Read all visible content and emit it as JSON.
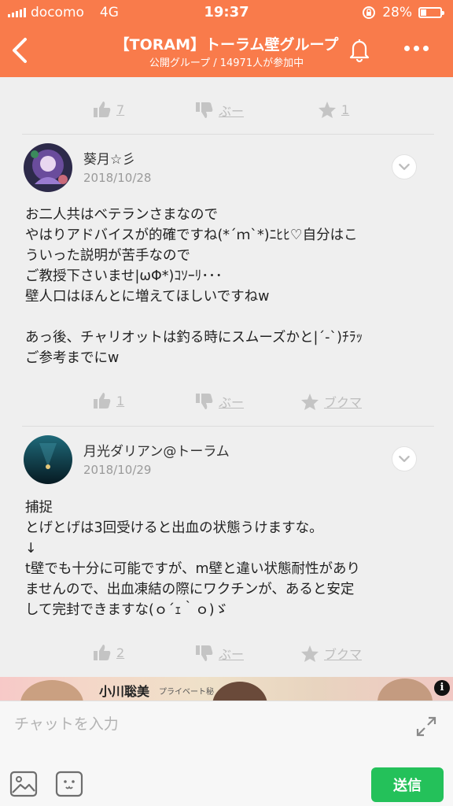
{
  "status_bar": {
    "carrier": "docomo",
    "network": "4G",
    "time": "19:37",
    "battery": "28%",
    "battery_level": 0.28
  },
  "header": {
    "title": "【TORAM】トーラム壁グループ",
    "subtitle": "公開グループ / 14971人が参加中"
  },
  "top_reactions": {
    "like": "7",
    "boo": "ぶー",
    "star": "1"
  },
  "posts": [
    {
      "author": "葵月☆彡",
      "date": "2018/10/28",
      "body": "お二人共はベテランさまなので\nやはりアドバイスが的確ですね(*´ｍ`*)ﾆﾋﾋ♡自分はこ\nういった説明が苦手なので\nご教授下さいませ|ωΦ*)ｺｿｰﾘ･･･\n壁人口はほんとに増えてほしいですねw\n\nあっ後、チャリオットは釣る時にスムーズかと|´-`)ﾁﾗｯ\nご参考までにw",
      "reactions": {
        "like": "1",
        "boo": "ぶー",
        "bookmark": "ブクマ"
      }
    },
    {
      "author": "月光ダリアン@トーラム",
      "date": "2018/10/29",
      "body": "捕捉\nとげとげは3回受けると出血の状態うけますな。\n↓\nt壁でも十分に可能ですが、m壁と違い状態耐性があり\nませんので、出血凍結の際にワクチンが、あると安定\nして完封できますな(ｏ´ｪ｀ｏ)ゞ",
      "reactions": {
        "like": "2",
        "boo": "ぶー",
        "bookmark": "ブクマ"
      }
    }
  ],
  "ad": {
    "name": "小川聡美",
    "sub": "プライベート秘",
    "info": "i"
  },
  "composer": {
    "placeholder": "チャットを入力",
    "send_label": "送信"
  },
  "colors": {
    "accent": "#f97b4b",
    "send": "#24c15a"
  }
}
